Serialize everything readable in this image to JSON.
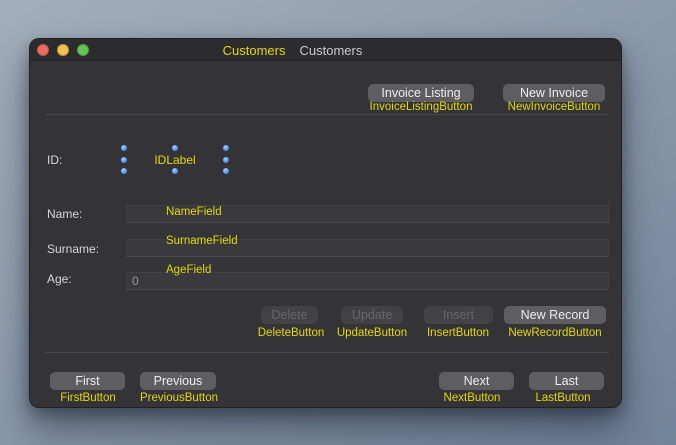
{
  "titlebar": {
    "annotation": "Customers",
    "title": "Customers",
    "traffic_lights": [
      "close",
      "minimize",
      "zoom"
    ]
  },
  "top_buttons": [
    {
      "label": "Invoice Listing",
      "annotation": "InvoiceListingButton",
      "enabled": true
    },
    {
      "label": "New Invoice",
      "annotation": "NewInvoiceButton",
      "enabled": true
    }
  ],
  "form": {
    "id_row": {
      "label": "ID:",
      "annotation": "IDLabel",
      "selected": true,
      "handle_count": 8
    },
    "fields": [
      {
        "label": "Name:",
        "annotation": "NameField",
        "value": ""
      },
      {
        "label": "Surname:",
        "annotation": "SurnameField",
        "value": ""
      },
      {
        "label": "Age:",
        "annotation": "AgeField",
        "value": "0"
      }
    ]
  },
  "record_buttons": [
    {
      "label": "Delete",
      "annotation": "DeleteButton",
      "enabled": false
    },
    {
      "label": "Update",
      "annotation": "UpdateButton",
      "enabled": false
    },
    {
      "label": "Insert",
      "annotation": "InsertButton",
      "enabled": false
    },
    {
      "label": "New Record",
      "annotation": "NewRecordButton",
      "enabled": true
    }
  ],
  "nav_buttons": [
    {
      "label": "First",
      "annotation": "FirstButton"
    },
    {
      "label": "Previous",
      "annotation": "PreviousButton"
    },
    {
      "label": "Next",
      "annotation": "NextButton"
    },
    {
      "label": "Last",
      "annotation": "LastButton"
    }
  ],
  "colors": {
    "annotation_yellow": "#e3da00",
    "selection_handle_blue": "#3b86ec",
    "window_background": "#343436",
    "titlebar_background": "#2c2c2e",
    "button_background": "#5e5e60",
    "button_disabled_background": "#424244",
    "field_background": "#3a3a3c",
    "desktop_top": "#a3aebc",
    "desktop_bottom": "#71839a",
    "traffic_red": "#ed6a5e",
    "traffic_yellow": "#f5bf4f",
    "traffic_green": "#61c554"
  }
}
